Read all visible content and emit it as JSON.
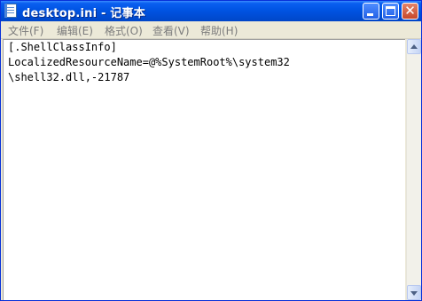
{
  "window": {
    "title": "desktop.ini - 记事本"
  },
  "menu": {
    "items": [
      {
        "label": "文件(F)"
      },
      {
        "label": "编辑(E)"
      },
      {
        "label": "格式(O)"
      },
      {
        "label": "查看(V)"
      },
      {
        "label": "帮助(H)"
      }
    ]
  },
  "editor": {
    "lines": [
      "[.ShellClassInfo]",
      "LocalizedResourceName=@%SystemRoot%\\system32",
      "\\shell32.dll,-21787"
    ]
  },
  "colors": {
    "titlebar": "#0054e3",
    "close_button": "#c6482b",
    "menubar": "#ece9d8"
  },
  "icons": [
    "notepad-icon",
    "minimize-icon",
    "maximize-icon",
    "close-icon",
    "scroll-up-arrow-icon",
    "scroll-down-arrow-icon"
  ]
}
